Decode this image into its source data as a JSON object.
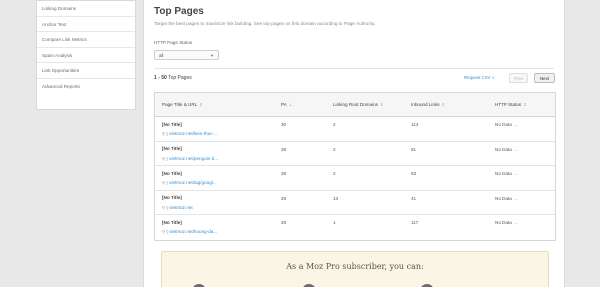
{
  "sidebar": {
    "items": [
      {
        "label": "Linking Domains"
      },
      {
        "label": "Anchor Text"
      },
      {
        "label": "Compare Link Metrics"
      },
      {
        "label": "Spam Analysis"
      },
      {
        "label": "Link Opportunities"
      },
      {
        "label": "Advanced Reports"
      }
    ]
  },
  "main": {
    "title": "Top Pages",
    "subtitle": "Target the best pages to maximize link building. See top pages on this domain according to Page Authority.",
    "filter": {
      "label": "HTTP Page Status",
      "value": "all"
    },
    "results": {
      "range": "1 - 50",
      "label": "Top Pages"
    },
    "export_label": "Request CSV",
    "prev_label": "Prev",
    "next_label": "Next",
    "table": {
      "headers": {
        "title_url": "Page Title & URL",
        "pa": "PA",
        "linking_root_domains": "Linking Root Domains",
        "inbound_links": "Inbound Links",
        "http_status": "HTTP Status"
      },
      "rows": [
        {
          "title": "[No Title]",
          "url": "vietmoz.net/kien-thuc-...",
          "pa": "30",
          "lrd": "2",
          "inbound": "114",
          "status": "No Data"
        },
        {
          "title": "[No Title]",
          "url": "vietmoz.net/penguin-d...",
          "pa": "29",
          "pa_note": "",
          "lrd": "2",
          "inbound": "81",
          "status": "No Data"
        },
        {
          "title": "[No Title]",
          "url": "vietmoz.net/tag/googl...",
          "pa": "29",
          "lrd": "2",
          "inbound": "63",
          "status": "No Data"
        },
        {
          "title": "[No Title]",
          "url": "vietmoz.net",
          "pa": "29",
          "lrd": "13",
          "inbound": "41",
          "status": "No Data"
        },
        {
          "title": "[No Title]",
          "url": "vietmoz.net/huong-da...",
          "pa": "28",
          "lrd": "1",
          "inbound": "117",
          "status": "No Data"
        }
      ]
    },
    "promo_title": "As a Moz Pro subscriber, you can:"
  },
  "colors": {
    "link": "#3b8bc9",
    "promo_bg": "#fbf5e5",
    "page_bg": "#e8e8e8"
  },
  "icons": [
    "chevron-down-icon",
    "sort-icon",
    "magnifier-icon",
    "page-icon",
    "download-icon"
  ]
}
